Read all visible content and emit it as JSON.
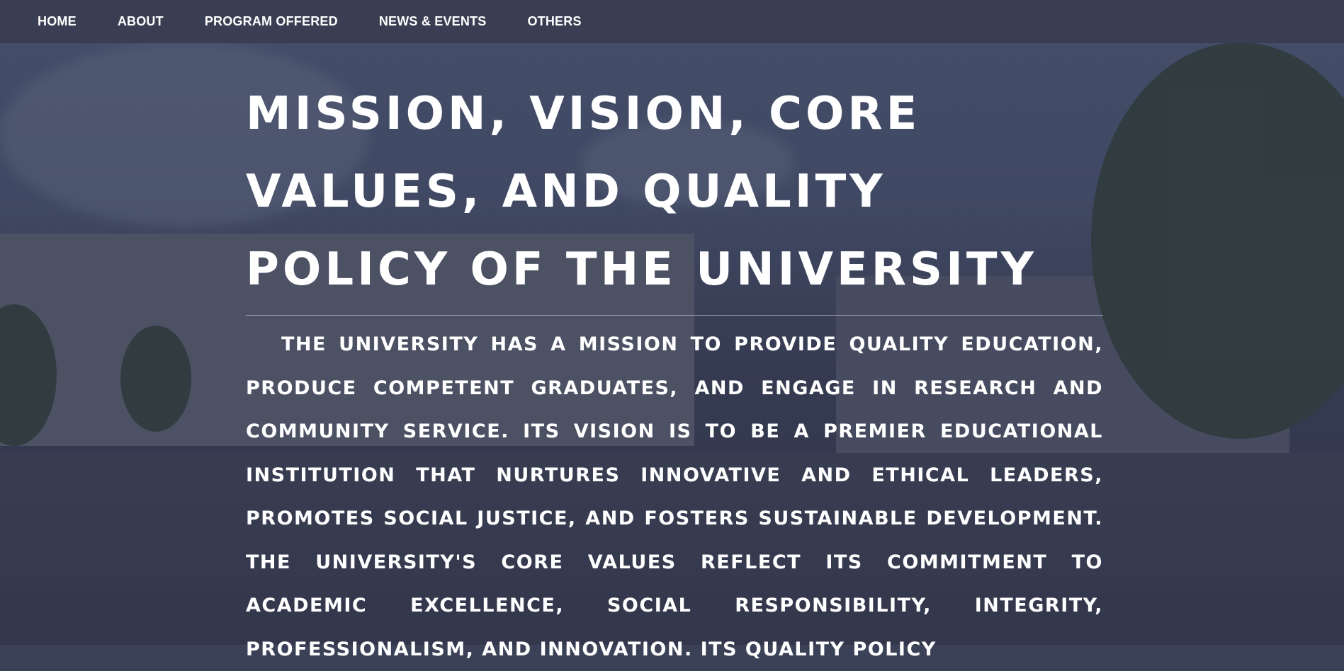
{
  "nav": {
    "items": [
      {
        "label": "HOME"
      },
      {
        "label": "ABOUT"
      },
      {
        "label": "PROGRAM OFFERED"
      },
      {
        "label": "NEWS & EVENTS"
      },
      {
        "label": "OTHERS"
      }
    ]
  },
  "hero": {
    "title": "MISSION, VISION, CORE VALUES, AND QUALITY POLICY OF THE UNIVERSITY",
    "body": "THE UNIVERSITY HAS A MISSION TO PROVIDE QUALITY EDUCATION, PRODUCE COMPETENT GRADUATES, AND ENGAGE IN RESEARCH AND COMMUNITY SERVICE. ITS VISION IS TO BE A PREMIER EDUCATIONAL INSTITUTION THAT NURTURES INNOVATIVE AND ETHICAL LEADERS, PROMOTES SOCIAL JUSTICE, AND FOSTERS SUSTAINABLE DEVELOPMENT. THE UNIVERSITY'S CORE VALUES REFLECT ITS COMMITMENT TO ACADEMIC EXCELLENCE, SOCIAL RESPONSIBILITY, INTEGRITY, PROFESSIONALISM, AND INNOVATION. ITS QUALITY POLICY"
  },
  "colors": {
    "nav_background": "#3a3e52",
    "text": "#ffffff",
    "overlay": "#282d46"
  }
}
